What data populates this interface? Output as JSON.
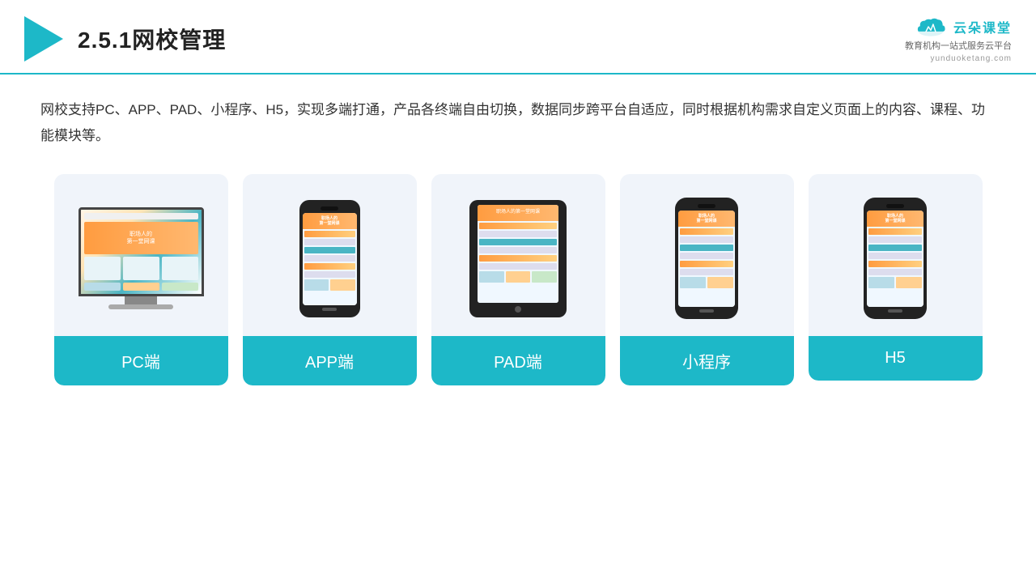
{
  "header": {
    "title": "2.5.1网校管理",
    "brand_name": "云朵课堂",
    "brand_slogan_line1": "教育机构一站",
    "brand_slogan_line2": "式服务云平台",
    "brand_url": "yunduoketang.com"
  },
  "description": "网校支持PC、APP、PAD、小程序、H5，实现多端打通，产品各终端自由切换，数据同步跨平台自适应，同时根据机构需求自定义页面上的内容、课程、功能模块等。",
  "cards": [
    {
      "id": "pc",
      "label": "PC端"
    },
    {
      "id": "app",
      "label": "APP端"
    },
    {
      "id": "pad",
      "label": "PAD端"
    },
    {
      "id": "mini",
      "label": "小程序"
    },
    {
      "id": "h5",
      "label": "H5"
    }
  ],
  "colors": {
    "teal": "#1db8c8",
    "accent_orange": "#ff9c40",
    "bg_card": "#eef2f9"
  }
}
